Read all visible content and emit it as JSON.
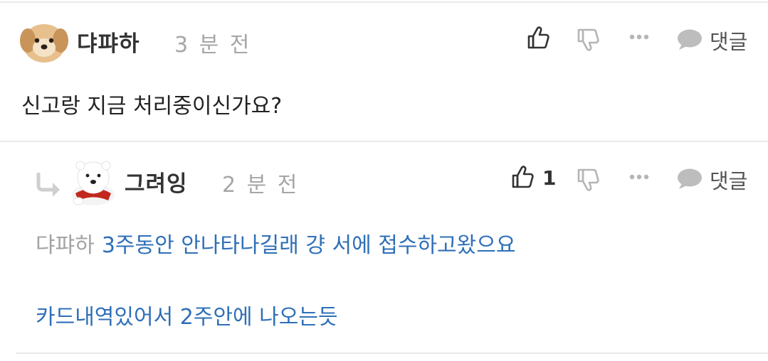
{
  "comments": [
    {
      "author": "댜퍄하",
      "time": "3 분 전",
      "text": "신고랑 지금 처리중이신가요?",
      "reply_label": "댓글"
    },
    {
      "author": "그려잉",
      "time": "2 분 전",
      "like_count": "1",
      "mention": "댜퍄하",
      "text_line1": "3주동안 안나타나길래 걍 서에 접수하고왔으요",
      "text_line2": "카드내역있어서 2주안에 나오는듯",
      "reply_label": "댓글"
    }
  ],
  "icons": {
    "like": "thumbs-up-icon",
    "dislike": "thumbs-down-icon",
    "more": "more-dots-icon",
    "reply": "speech-bubble-icon",
    "reply_arrow": "reply-arrow-icon"
  },
  "colors": {
    "link_blue": "#2f6fb7",
    "meta_gray": "#a6a6a6",
    "divider": "#e9e9e9"
  }
}
